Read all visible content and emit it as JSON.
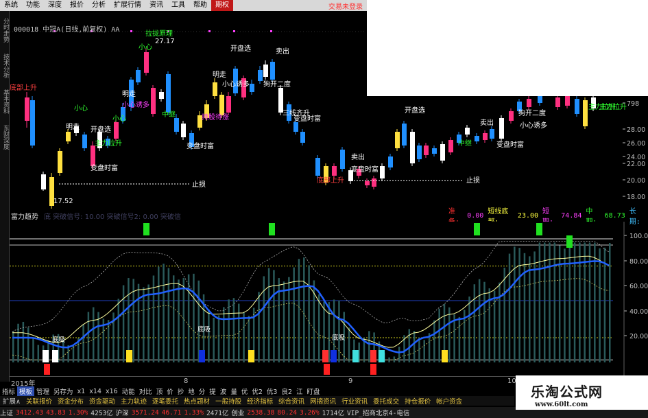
{
  "menubar": {
    "items": [
      "系统",
      "功能",
      "深度",
      "报价",
      "分析",
      "扩展行情",
      "资讯",
      "工具",
      "帮助",
      "期权"
    ],
    "active_index": 9,
    "right_text": "交易未登录"
  },
  "vtabs": [
    "分时走势",
    "技术分析",
    "基本资料",
    "东财深度"
  ],
  "stock": {
    "code": "000018",
    "title": "中冠A(日线,前复权) AA"
  },
  "price_axis": [
    "798",
    "28.00",
    "26.00",
    "24.00",
    "22.00",
    "20.00",
    "18.00"
  ],
  "price_labels": {
    "high": "27.17",
    "low": "17.52",
    "stop1": "止损",
    "stop2": "止损"
  },
  "signals": [
    {
      "text": "底部上升",
      "color": "#ff4040"
    },
    {
      "text": "小心",
      "color": "#30ff30"
    },
    {
      "text": "明走",
      "color": "#ffffff"
    },
    {
      "text": "开盘选",
      "color": "#ffffff"
    },
    {
      "text": "主力拉升",
      "color": "#30ff30"
    },
    {
      "text": "变盘时富",
      "color": "#ffffff"
    },
    {
      "text": "小心",
      "color": "#30ff30"
    },
    {
      "text": "拉拢原理",
      "color": "#30ff30"
    },
    {
      "text": "小心",
      "color": "#30ff30"
    },
    {
      "text": "明走",
      "color": "#ffffff"
    },
    {
      "text": "小心诱多",
      "color": "#ff40ff"
    },
    {
      "text": "中继",
      "color": "#30ff30"
    },
    {
      "text": "变盘时富",
      "color": "#ffffff"
    },
    {
      "text": "开盘选",
      "color": "#ffffff"
    },
    {
      "text": "卖出",
      "color": "#ffffff"
    },
    {
      "text": "明走",
      "color": "#ffffff"
    },
    {
      "text": "小心诱多",
      "color": "#ffffff"
    },
    {
      "text": "狗开二度",
      "color": "#ffffff"
    },
    {
      "text": "持股待涨",
      "color": "#ff40ff"
    },
    {
      "text": "三线齐升",
      "color": "#ffffff"
    },
    {
      "text": "变盘时富",
      "color": "#ffffff"
    },
    {
      "text": "卖出",
      "color": "#ffffff"
    },
    {
      "text": "变盘时富",
      "color": "#ffffff"
    },
    {
      "text": "主力拉升",
      "color": "#30ff30"
    },
    {
      "text": "底部上升",
      "color": "#ff4040"
    },
    {
      "text": "开盘选",
      "color": "#ffffff"
    },
    {
      "text": "卖出",
      "color": "#ffffff"
    },
    {
      "text": "中继",
      "color": "#30ff30"
    },
    {
      "text": "变盘时富",
      "color": "#ffffff"
    },
    {
      "text": "狗开二度",
      "color": "#ffffff"
    },
    {
      "text": "小心诱多",
      "color": "#ffffff"
    },
    {
      "text": "主力拉升",
      "color": "#30ff30"
    }
  ],
  "indicator": {
    "name": "富力趋势",
    "params_dim": "底 突破信号: 10.00  突破信号2: 0.00  突破信",
    "right": [
      {
        "label": "准备:",
        "value": "0.00",
        "lc": "#ff3030",
        "vc": "#ff40ff"
      },
      {
        "label": "短线底部:",
        "value": "23.00",
        "lc": "#ffff40",
        "vc": "#ffff40"
      },
      {
        "label": "短期:",
        "value": "74.84",
        "lc": "#ff40ff",
        "vc": "#ff40ff"
      },
      {
        "label": "中期:",
        "value": "68.73",
        "lc": "#30ff30",
        "vc": "#30ff30"
      },
      {
        "label": "长期:",
        "value": "",
        "lc": "#40c0ff",
        "vc": "#40c0ff"
      }
    ],
    "axis": [
      "100.0",
      "80.00",
      "60.00",
      "40.00",
      "20.00"
    ],
    "bottom_labels": [
      "底吸",
      "底吸",
      "底吸"
    ],
    "top_marker_char": "涨"
  },
  "timeaxis": {
    "labels": [
      "2015年",
      "8",
      "9",
      "10"
    ]
  },
  "toolrow1": {
    "items": [
      "指标",
      "模板",
      "管理",
      "另存为",
      "x1",
      "x14",
      "x16",
      "动能",
      "对比",
      "顶",
      "价",
      "抄",
      "地",
      "分",
      "提",
      "波",
      "量",
      "优",
      "优2",
      "优3",
      "良2",
      "江",
      "盯盘"
    ],
    "on_index": 1
  },
  "toolrow2": {
    "items": [
      "扩展∧",
      "关联报价",
      "资金分布",
      "资金驱动",
      "主力轨迹",
      "逐笔委托",
      "热点题材",
      "一般持股",
      "经济指标",
      "综合资讯",
      "网摘资讯",
      "行业资讯",
      "委托成交",
      "持仓报价",
      "帐户资金"
    ]
  },
  "statusbar": {
    "items": [
      {
        "t": "上证",
        "c": "lbl"
      },
      {
        "t": "3412.43",
        "c": "red"
      },
      {
        "t": "43.83",
        "c": "red"
      },
      {
        "t": "1.30%",
        "c": "red"
      },
      {
        "t": "4253亿",
        "c": "wht"
      },
      {
        "t": "沪深",
        "c": "lbl"
      },
      {
        "t": "3571.24",
        "c": "red"
      },
      {
        "t": "46.71",
        "c": "red"
      },
      {
        "t": "1.33%",
        "c": "red"
      },
      {
        "t": "2471亿",
        "c": "wht"
      },
      {
        "t": "创业",
        "c": "lbl"
      },
      {
        "t": "2538.38",
        "c": "red"
      },
      {
        "t": "80.24",
        "c": "red"
      },
      {
        "t": "3.26%",
        "c": "red"
      },
      {
        "t": "1714亿",
        "c": "wht"
      },
      {
        "t": "VIP_招商北京4-电信",
        "c": "wht"
      }
    ]
  },
  "watermark": {
    "line1": "乐淘公式网",
    "line2": "www.60lt.com"
  },
  "colors": {
    "up": "#ff3080",
    "down": "#2090ff",
    "yellow": "#ffe040",
    "white": "#ffffff",
    "green": "#30ff30",
    "bg": "#000000"
  }
}
